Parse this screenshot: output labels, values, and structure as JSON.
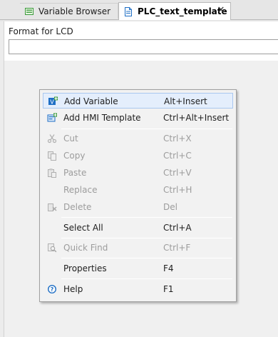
{
  "tabs": [
    {
      "label": "Variable Browser",
      "active": false,
      "icon": "variable-browser-icon"
    },
    {
      "label": "PLC_text_template",
      "active": true,
      "icon": "document-icon",
      "close": "✕"
    }
  ],
  "editor": {
    "field_label": "Format for LCD",
    "field_value": ""
  },
  "context_menu": {
    "items": [
      {
        "label": "Add Variable",
        "shortcut": "Alt+Insert",
        "enabled": true,
        "highlighted": true,
        "icon": "add-variable-icon"
      },
      {
        "label": "Add HMI Template",
        "shortcut": "Ctrl+Alt+Insert",
        "enabled": true,
        "icon": "add-hmi-template-icon"
      },
      {
        "label": "Cut",
        "shortcut": "Ctrl+X",
        "enabled": false,
        "icon": "scissors-icon"
      },
      {
        "label": "Copy",
        "shortcut": "Ctrl+C",
        "enabled": false,
        "icon": "copy-icon"
      },
      {
        "label": "Paste",
        "shortcut": "Ctrl+V",
        "enabled": false,
        "icon": "paste-icon"
      },
      {
        "label": "Replace",
        "shortcut": "Ctrl+H",
        "enabled": false
      },
      {
        "label": "Delete",
        "shortcut": "Del",
        "enabled": false,
        "icon": "delete-icon"
      },
      {
        "label": "Select All",
        "shortcut": "Ctrl+A",
        "enabled": true
      },
      {
        "label": "Quick Find",
        "shortcut": "Ctrl+F",
        "enabled": false,
        "icon": "quick-find-icon"
      },
      {
        "label": "Properties",
        "shortcut": "F4",
        "enabled": true
      },
      {
        "label": "Help",
        "shortcut": "F1",
        "enabled": true,
        "icon": "help-icon"
      }
    ]
  },
  "colors": {
    "highlight_bg": "#e4eefc",
    "highlight_border": "#a9c7ef",
    "disabled_text": "#9c9c9c",
    "accent_blue": "#1f6fc5",
    "accent_green": "#3a9a3a"
  }
}
